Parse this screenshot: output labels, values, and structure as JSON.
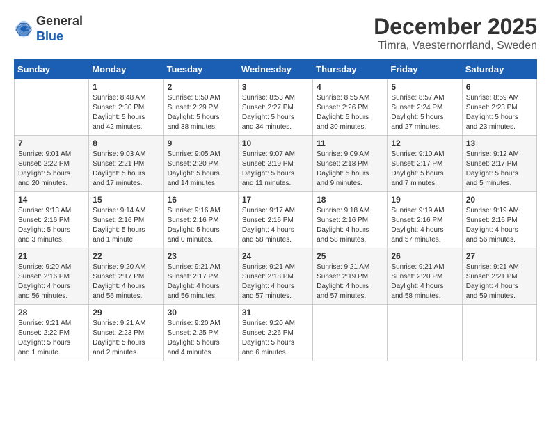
{
  "header": {
    "logo_general": "General",
    "logo_blue": "Blue",
    "title": "December 2025",
    "subtitle": "Timra, Vaesternorrland, Sweden"
  },
  "days_of_week": [
    "Sunday",
    "Monday",
    "Tuesday",
    "Wednesday",
    "Thursday",
    "Friday",
    "Saturday"
  ],
  "weeks": [
    [
      {
        "day": "",
        "info": ""
      },
      {
        "day": "1",
        "info": "Sunrise: 8:48 AM\nSunset: 2:30 PM\nDaylight: 5 hours\nand 42 minutes."
      },
      {
        "day": "2",
        "info": "Sunrise: 8:50 AM\nSunset: 2:29 PM\nDaylight: 5 hours\nand 38 minutes."
      },
      {
        "day": "3",
        "info": "Sunrise: 8:53 AM\nSunset: 2:27 PM\nDaylight: 5 hours\nand 34 minutes."
      },
      {
        "day": "4",
        "info": "Sunrise: 8:55 AM\nSunset: 2:26 PM\nDaylight: 5 hours\nand 30 minutes."
      },
      {
        "day": "5",
        "info": "Sunrise: 8:57 AM\nSunset: 2:24 PM\nDaylight: 5 hours\nand 27 minutes."
      },
      {
        "day": "6",
        "info": "Sunrise: 8:59 AM\nSunset: 2:23 PM\nDaylight: 5 hours\nand 23 minutes."
      }
    ],
    [
      {
        "day": "7",
        "info": "Sunrise: 9:01 AM\nSunset: 2:22 PM\nDaylight: 5 hours\nand 20 minutes."
      },
      {
        "day": "8",
        "info": "Sunrise: 9:03 AM\nSunset: 2:21 PM\nDaylight: 5 hours\nand 17 minutes."
      },
      {
        "day": "9",
        "info": "Sunrise: 9:05 AM\nSunset: 2:20 PM\nDaylight: 5 hours\nand 14 minutes."
      },
      {
        "day": "10",
        "info": "Sunrise: 9:07 AM\nSunset: 2:19 PM\nDaylight: 5 hours\nand 11 minutes."
      },
      {
        "day": "11",
        "info": "Sunrise: 9:09 AM\nSunset: 2:18 PM\nDaylight: 5 hours\nand 9 minutes."
      },
      {
        "day": "12",
        "info": "Sunrise: 9:10 AM\nSunset: 2:17 PM\nDaylight: 5 hours\nand 7 minutes."
      },
      {
        "day": "13",
        "info": "Sunrise: 9:12 AM\nSunset: 2:17 PM\nDaylight: 5 hours\nand 5 minutes."
      }
    ],
    [
      {
        "day": "14",
        "info": "Sunrise: 9:13 AM\nSunset: 2:16 PM\nDaylight: 5 hours\nand 3 minutes."
      },
      {
        "day": "15",
        "info": "Sunrise: 9:14 AM\nSunset: 2:16 PM\nDaylight: 5 hours\nand 1 minute."
      },
      {
        "day": "16",
        "info": "Sunrise: 9:16 AM\nSunset: 2:16 PM\nDaylight: 5 hours\nand 0 minutes."
      },
      {
        "day": "17",
        "info": "Sunrise: 9:17 AM\nSunset: 2:16 PM\nDaylight: 4 hours\nand 58 minutes."
      },
      {
        "day": "18",
        "info": "Sunrise: 9:18 AM\nSunset: 2:16 PM\nDaylight: 4 hours\nand 58 minutes."
      },
      {
        "day": "19",
        "info": "Sunrise: 9:19 AM\nSunset: 2:16 PM\nDaylight: 4 hours\nand 57 minutes."
      },
      {
        "day": "20",
        "info": "Sunrise: 9:19 AM\nSunset: 2:16 PM\nDaylight: 4 hours\nand 56 minutes."
      }
    ],
    [
      {
        "day": "21",
        "info": "Sunrise: 9:20 AM\nSunset: 2:16 PM\nDaylight: 4 hours\nand 56 minutes."
      },
      {
        "day": "22",
        "info": "Sunrise: 9:20 AM\nSunset: 2:17 PM\nDaylight: 4 hours\nand 56 minutes."
      },
      {
        "day": "23",
        "info": "Sunrise: 9:21 AM\nSunset: 2:17 PM\nDaylight: 4 hours\nand 56 minutes."
      },
      {
        "day": "24",
        "info": "Sunrise: 9:21 AM\nSunset: 2:18 PM\nDaylight: 4 hours\nand 57 minutes."
      },
      {
        "day": "25",
        "info": "Sunrise: 9:21 AM\nSunset: 2:19 PM\nDaylight: 4 hours\nand 57 minutes."
      },
      {
        "day": "26",
        "info": "Sunrise: 9:21 AM\nSunset: 2:20 PM\nDaylight: 4 hours\nand 58 minutes."
      },
      {
        "day": "27",
        "info": "Sunrise: 9:21 AM\nSunset: 2:21 PM\nDaylight: 4 hours\nand 59 minutes."
      }
    ],
    [
      {
        "day": "28",
        "info": "Sunrise: 9:21 AM\nSunset: 2:22 PM\nDaylight: 5 hours\nand 1 minute."
      },
      {
        "day": "29",
        "info": "Sunrise: 9:21 AM\nSunset: 2:23 PM\nDaylight: 5 hours\nand 2 minutes."
      },
      {
        "day": "30",
        "info": "Sunrise: 9:20 AM\nSunset: 2:25 PM\nDaylight: 5 hours\nand 4 minutes."
      },
      {
        "day": "31",
        "info": "Sunrise: 9:20 AM\nSunset: 2:26 PM\nDaylight: 5 hours\nand 6 minutes."
      },
      {
        "day": "",
        "info": ""
      },
      {
        "day": "",
        "info": ""
      },
      {
        "day": "",
        "info": ""
      }
    ]
  ]
}
